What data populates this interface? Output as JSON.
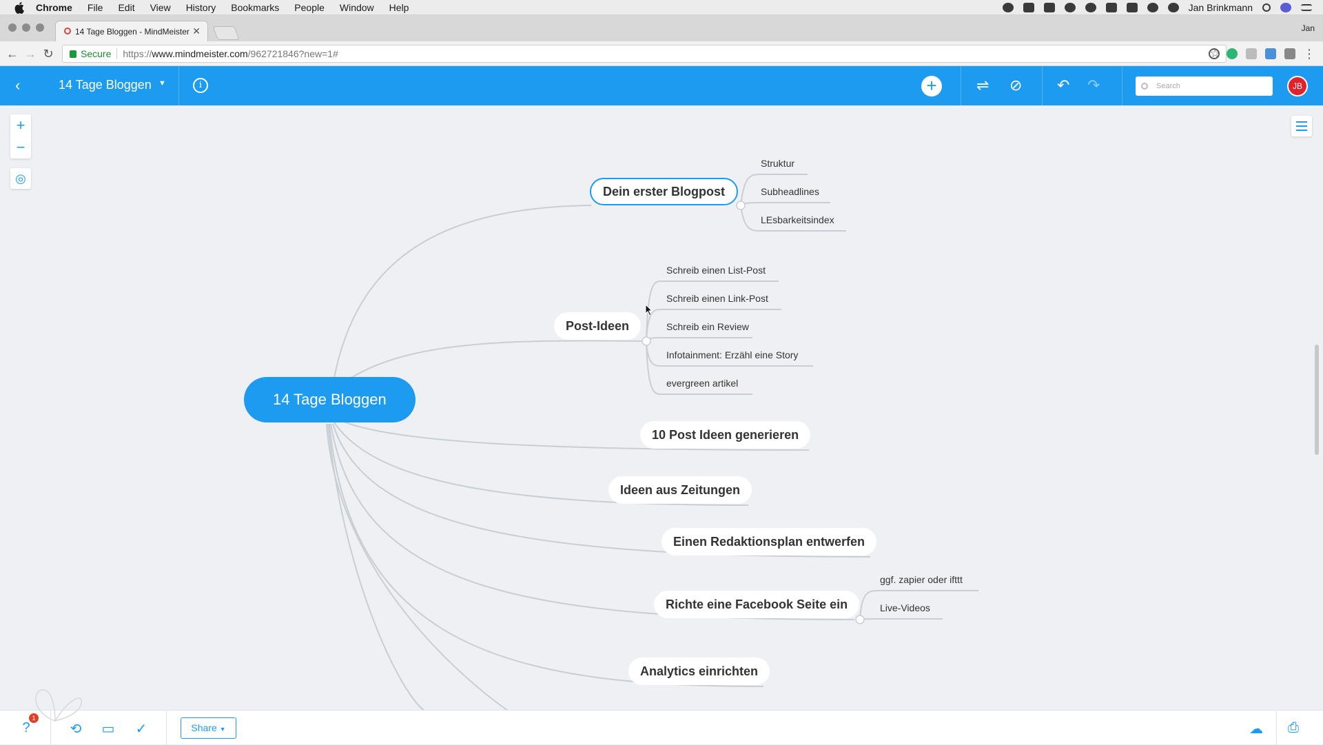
{
  "menubar": {
    "app": "Chrome",
    "items": [
      "File",
      "Edit",
      "View",
      "History",
      "Bookmarks",
      "People",
      "Window",
      "Help"
    ],
    "user": "Jan Brinkmann"
  },
  "browser": {
    "tab_title": "14 Tage Bloggen - MindMeister",
    "profile": "Jan",
    "secure_label": "Secure",
    "url_scheme": "https://",
    "url_host": "www.mindmeister.com",
    "url_path": "/962721846?new=1#"
  },
  "app": {
    "map_title": "14 Tage Bloggen",
    "search_placeholder": "Search",
    "avatar_initials": "JB"
  },
  "mindmap": {
    "root": "14 Tage Bloggen",
    "branches": [
      {
        "label": "Dein erster Blogpost",
        "children": [
          "Struktur",
          "Subheadlines",
          "LEsbarkeitsindex"
        ]
      },
      {
        "label": "Post-Ideen",
        "children": [
          "Schreib einen List-Post",
          "Schreib einen Link-Post",
          "Schreib ein Review",
          "Infotainment: Erzähl eine Story",
          "evergreen artikel"
        ]
      },
      {
        "label": "10 Post Ideen generieren",
        "children": []
      },
      {
        "label": "Ideen aus Zeitungen",
        "children": []
      },
      {
        "label": "Einen Redaktionsplan entwerfen",
        "children": []
      },
      {
        "label": "Richte eine Facebook Seite ein",
        "children": [
          "ggf. zapier oder ifttt",
          "Live-Videos"
        ]
      },
      {
        "label": "Analytics einrichten",
        "children": []
      }
    ]
  },
  "bottom": {
    "share_label": "Share",
    "notification_count": "1"
  },
  "colors": {
    "accent": "#1d9bf0",
    "canvas": "#eef0f3",
    "link": "#c9ced4",
    "avatar": "#e0222e"
  }
}
